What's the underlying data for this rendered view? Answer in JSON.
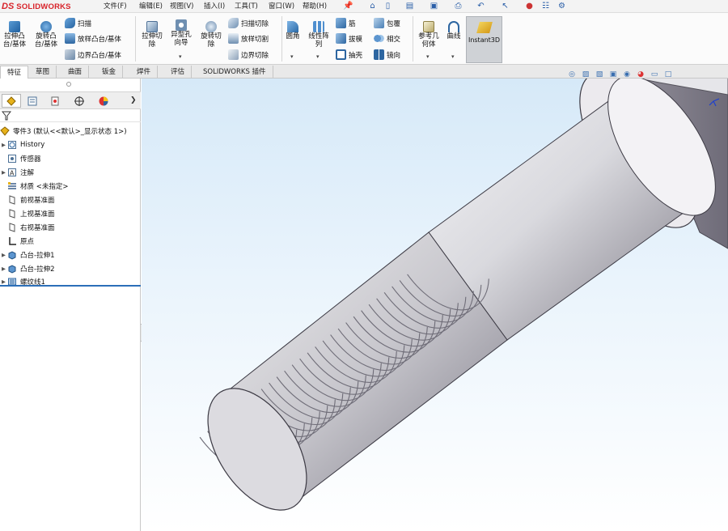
{
  "app": {
    "brand_prefix": "DS",
    "brand_name": "SOLIDWORKS"
  },
  "menu": [
    "文件(F)",
    "编辑(E)",
    "视图(V)",
    "插入(I)",
    "工具(T)",
    "窗口(W)",
    "帮助(H)"
  ],
  "quick_access_icons": [
    "pin-icon",
    "home-icon",
    "new-file-icon",
    "open-file-icon",
    "save-icon",
    "print-icon",
    "undo-icon",
    "select-icon",
    "traffic-light-icon",
    "file-properties-icon",
    "gear-icon"
  ],
  "ribbon": {
    "extrude_boss": "拉伸凸\n台/基体",
    "revolve_boss": "旋转凸\n台/基体",
    "sweep": "扫描",
    "loft_boss": "放样凸台/基体",
    "boundary_boss": "边界凸台/基体",
    "extrude_cut": "拉伸切\n除",
    "hole_wizard": "异型孔\n向导",
    "revolve_cut": "旋转切\n除",
    "sweep_cut": "扫描切除",
    "loft_cut": "放样切割",
    "boundary_cut": "边界切除",
    "fillet": "圆角",
    "linear_pattern": "线性阵\n列",
    "rib": "筋",
    "draft": "拔模",
    "shell": "抽壳",
    "wrap": "包覆",
    "intersect": "相交",
    "mirror": "镜向",
    "ref_geometry": "参考几\n何体",
    "curves": "曲线",
    "instant3d": "Instant3D"
  },
  "tabs": [
    {
      "label": "特征",
      "active": true
    },
    {
      "label": "草图",
      "active": false
    },
    {
      "label": "曲面",
      "active": false
    },
    {
      "label": "钣金",
      "active": false
    },
    {
      "label": "焊件",
      "active": false
    },
    {
      "label": "评估",
      "active": false
    },
    {
      "label": "SOLIDWORKS 插件",
      "active": false
    }
  ],
  "panel_tabs": [
    "feature-manager-icon",
    "property-manager-icon",
    "configuration-manager-icon",
    "dimxpert-icon",
    "display-manager-icon"
  ],
  "tree": {
    "root": "零件3  (默认<<默认>_显示状态 1>)",
    "items": [
      {
        "label": "History",
        "icon": "history-icon",
        "expandable": true
      },
      {
        "label": "传感器",
        "icon": "sensor-icon",
        "expandable": false
      },
      {
        "label": "注解",
        "icon": "annotation-icon",
        "expandable": true
      },
      {
        "label": "材质 <未指定>",
        "icon": "material-icon",
        "expandable": false
      },
      {
        "label": "前视基准面",
        "icon": "plane-icon",
        "expandable": false
      },
      {
        "label": "上视基准面",
        "icon": "plane-icon",
        "expandable": false
      },
      {
        "label": "右视基准面",
        "icon": "plane-icon",
        "expandable": false
      },
      {
        "label": "原点",
        "icon": "origin-icon",
        "expandable": false
      },
      {
        "label": "凸台-拉伸1",
        "icon": "extrude-feature-icon",
        "expandable": true
      },
      {
        "label": "凸台-拉伸2",
        "icon": "extrude-feature-icon",
        "expandable": true
      },
      {
        "label": "螺纹线1",
        "icon": "thread-feature-icon",
        "expandable": true
      }
    ]
  },
  "viewport_hud_icons": [
    "zoom-fit-icon",
    "section-view-icon",
    "view-orientation-icon",
    "display-style-icon",
    "hide-show-icon",
    "edit-appearance-icon",
    "scene-icon",
    "view-settings-icon"
  ],
  "colors": {
    "accent": "#2c6fb8",
    "brand": "#d8232a",
    "viewport_top": "#d6e9f8"
  }
}
